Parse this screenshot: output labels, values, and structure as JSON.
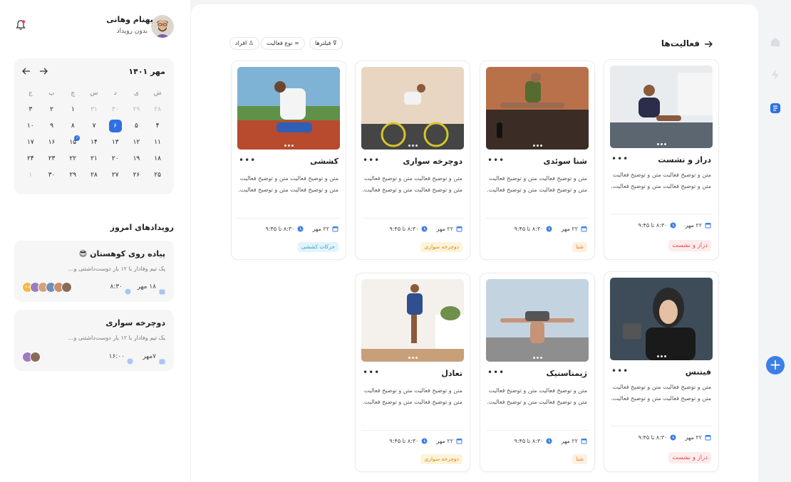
{
  "user": {
    "name": "بهنام وهانی",
    "status": "بدون رویداد"
  },
  "calendar": {
    "month_label": "مهر ۱۴۰۱",
    "weekdays": [
      "ش",
      "ی",
      "د",
      "س",
      "چ",
      "پ",
      "ج"
    ],
    "weeks": [
      [
        {
          "d": "۲۸",
          "m": 1
        },
        {
          "d": "۲۹",
          "m": 1
        },
        {
          "d": "۳۰",
          "m": 1
        },
        {
          "d": "۳۱",
          "m": 1
        },
        {
          "d": "۱"
        },
        {
          "d": "۲"
        },
        {
          "d": "۳"
        }
      ],
      [
        {
          "d": "۴"
        },
        {
          "d": "۵"
        },
        {
          "d": "۶",
          "sel": 1
        },
        {
          "d": "۷"
        },
        {
          "d": "۸"
        },
        {
          "d": "۹"
        },
        {
          "d": "۱۰"
        }
      ],
      [
        {
          "d": "۱۱"
        },
        {
          "d": "۱۲"
        },
        {
          "d": "۱۳"
        },
        {
          "d": "۱۴"
        },
        {
          "d": "۱۵",
          "badge": "۲"
        },
        {
          "d": "۱۶"
        },
        {
          "d": "۱۷"
        }
      ],
      [
        {
          "d": "۱۸"
        },
        {
          "d": "۱۹"
        },
        {
          "d": "۲۰"
        },
        {
          "d": "۲۱"
        },
        {
          "d": "۲۲"
        },
        {
          "d": "۲۳"
        },
        {
          "d": "۲۴"
        }
      ],
      [
        {
          "d": "۲۵"
        },
        {
          "d": "۲۶"
        },
        {
          "d": "۲۷"
        },
        {
          "d": "۲۸"
        },
        {
          "d": "۲۹"
        },
        {
          "d": "۳۰"
        },
        {
          "d": "۱",
          "m": 1
        }
      ]
    ]
  },
  "events": {
    "title": "رویدادهای امروز",
    "items": [
      {
        "title": "پیاده روی کوهستان 😎",
        "desc": "یک تیم وفادار با ۱۲ یار دوست‌داشتنی و...",
        "date": "۱۸ مهر",
        "time": "۸:۳۰",
        "more": "+۶"
      },
      {
        "title": "دوچرخه سواری",
        "desc": "یک تیم وفادار با ۱۲ یار دوست‌داشتنی و...",
        "date": "۷مهر",
        "time": "۱۶:۰۰"
      }
    ]
  },
  "main": {
    "title": "فعالیت‌ها",
    "chips": {
      "filters": "فیلترها",
      "type": "نوع فعالیت",
      "people": "افراد"
    }
  },
  "activities": [
    {
      "title": "دراز و نشست",
      "desc": "متن و توضیح فعالیت متن و توضیح فعالیت متن و توضیح فعالیت متن و توضیح فعالیت.",
      "date": "۲۲ مهر",
      "time": "۸:۳۰ تا ۹:۴۵",
      "tag": "دراز و نشست",
      "tag_color": "#e5484d",
      "tag_bg": "#fdecec"
    },
    {
      "title": "شنا سوئدی",
      "desc": "متن و توضیح فعالیت متن و توضیح فعالیت متن و توضیح فعالیت متن و توضیح فعالیت.",
      "date": "۲۲ مهر",
      "time": "۸:۳۰ تا ۹:۴۵",
      "tag": "شنا",
      "tag_color": "#e07b1a",
      "tag_bg": "#fdf0e1"
    },
    {
      "title": "دوچرخه سواری",
      "desc": "متن و توضیح فعالیت متن و توضیح فعالیت متن و توضیح فعالیت متن و توضیح فعالیت.",
      "date": "۲۲ مهر",
      "time": "۸:۳۰ تا ۹:۴۵",
      "tag": "دوچرخه سواری",
      "tag_color": "#d98a00",
      "tag_bg": "#fdf3dc"
    },
    {
      "title": "کششی",
      "desc": "متن و توضیح فعالیت متن و توضیح فعالیت متن و توضیح فعالیت متن و توضیح فعالیت.",
      "date": "۲۲ مهر",
      "time": "۸:۳۰ تا ۹:۴۵",
      "tag": "حرکات کششی",
      "tag_color": "#2d9fd8",
      "tag_bg": "#e3f3fb"
    },
    {
      "title": "فیتنس",
      "desc": "متن و توضیح فعالیت متن و توضیح فعالیت متن و توضیح فعالیت متن و توضیح فعالیت.",
      "date": "۲۲ مهر",
      "time": "۸:۳۰ تا ۹:۴۵",
      "tag": "دراز و نشست",
      "tag_color": "#e5484d",
      "tag_bg": "#fdecec"
    },
    {
      "title": "ژیمناستیک",
      "desc": "متن و توضیح فعالیت متن و توضیح فعالیت متن و توضیح فعالیت متن و توضیح فعالیت.",
      "date": "۲۲ مهر",
      "time": "۸:۳۰ تا ۹:۴۵",
      "tag": "شنا",
      "tag_color": "#e07b1a",
      "tag_bg": "#fdf0e1"
    },
    {
      "title": "تعادل",
      "desc": "متن و توضیح فعالیت متن و توضیح فعالیت متن و توضیح فعالیت متن و توضیح فعالیت.",
      "date": "۲۲ مهر",
      "time": "۸:۳۰ تا ۹:۴۵",
      "tag": "دوچرخه سواری",
      "tag_color": "#d98a00",
      "tag_bg": "#fdf3dc"
    }
  ],
  "icons": {
    "bell": "bell-icon",
    "back": "arrow-right-icon",
    "home": "home-icon",
    "bolt": "bolt-icon",
    "list": "list-icon",
    "add": "plus-icon"
  },
  "colors": {
    "accent": "#2f6fe4",
    "fab": "#3d7fe6"
  }
}
